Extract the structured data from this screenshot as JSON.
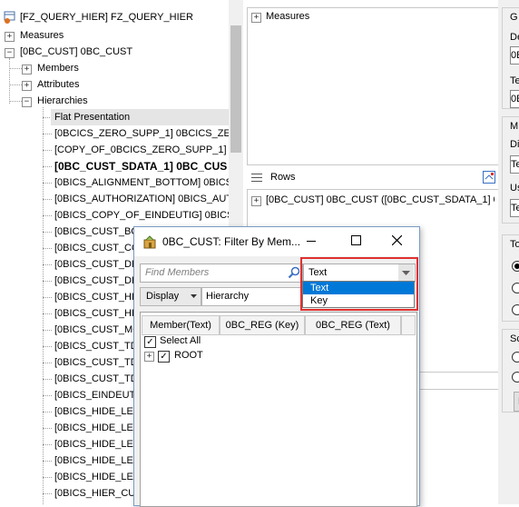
{
  "tree": {
    "root": "[FZ_QUERY_HIER] FZ_QUERY_HIER",
    "measures": "Measures",
    "dimension": "[0BC_CUST] 0BC_CUST",
    "members": "Members",
    "attributes": "Attributes",
    "hierarchies": "Hierarchies",
    "hierarchy_items": [
      "Flat Presentation",
      "[0BCICS_ZERO_SUPP_1] 0BCICS_ZERO_",
      "[COPY_OF_0BCICS_ZERO_SUPP_1] 0BC",
      "[0BC_CUST_SDATA_1] 0BC_CUS",
      "[0BICS_ALIGNMENT_BOTTOM] 0BICS_A",
      "[0BICS_AUTHORIZATION] 0BICS_AUTHO",
      "[0BICS_COPY_OF_EINDEUTIG] 0BICS_C",
      "[0BICS_CUST_BO",
      "[0BICS_CUST_COU",
      "[0BICS_CUST_DEE",
      "[0BICS_CUST_DEE",
      "[0BICS_CUST_HIER",
      "[0BICS_CUST_HIER",
      "[0BICS_CUST_MG",
      "[0BICS_CUST_TDE",
      "[0BICS_CUST_TDE",
      "[0BICS_CUST_TDE",
      "[0BICS_EINDEUTIC",
      "[0BICS_HIDE_LEVE",
      "[0BICS_HIDE_LEVE",
      "[0BICS_HIDE_LEVE",
      "[0BICS_HIDE_LEVE",
      "[0BICS_HIDE_LEVE",
      "[0BICS_HIER_CUS"
    ]
  },
  "top_panel": {
    "measures": "Measures"
  },
  "rows_panel": {
    "title": "Rows",
    "item": "[0BC_CUST] 0BC_CUST ([0BC_CUST_SDATA_1] 0BC_C"
  },
  "right_strip": {
    "g": "G",
    "de": "De",
    "ob1": "0B",
    "te": "Te",
    "ob2": "0E",
    "m": "M",
    "di": "Di",
    "t1": "Te",
    "us": "Us",
    "t2": "Te",
    "to": "To",
    "so": "Sc",
    "n": "N"
  },
  "dialog": {
    "title": "0BC_CUST: Filter By Mem...",
    "search_placeholder": "Find Members",
    "dropdown_value": "Text",
    "dropdown_options": [
      "Text",
      "Key"
    ],
    "display_label": "Display",
    "hierarchy_label": "Hierarchy",
    "columns": [
      "Member(Text)",
      "0BC_REG (Key)",
      "0BC_REG (Text)"
    ],
    "select_all": "Select All",
    "root": "ROOT"
  },
  "colors": {
    "selection_blue": "#0078d7",
    "highlight_red": "#e03030",
    "dialog_border": "#7a9bc5"
  }
}
